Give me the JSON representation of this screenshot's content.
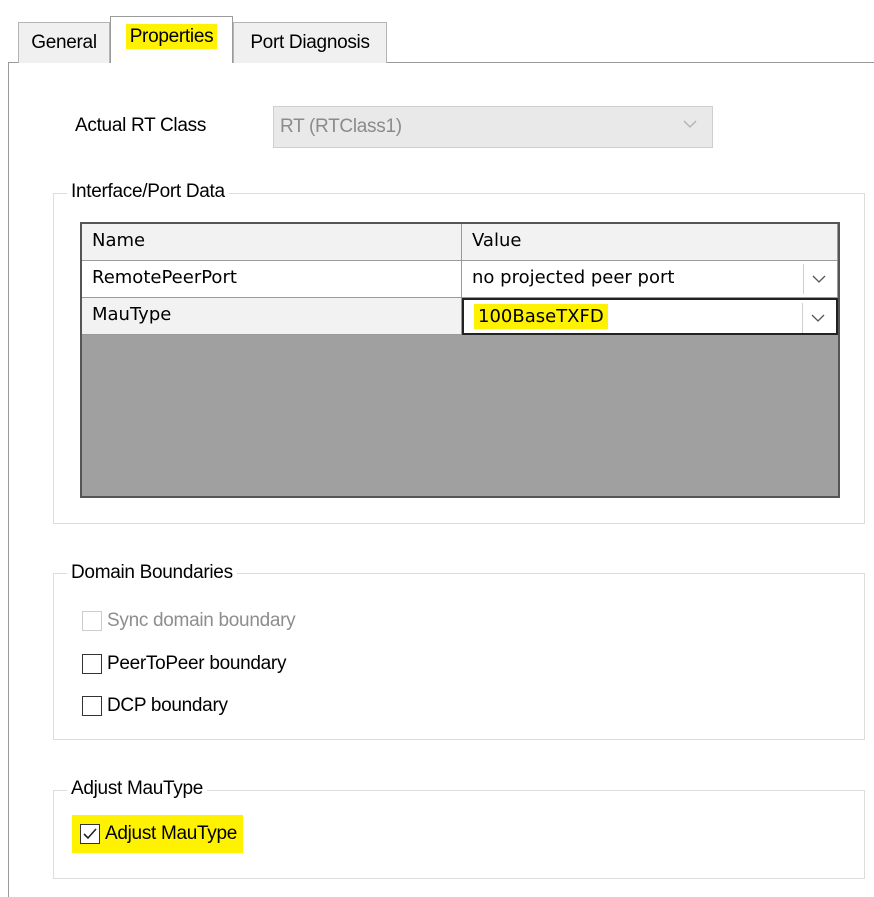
{
  "tabs": [
    {
      "label": "General",
      "active": false
    },
    {
      "label": "Properties",
      "active": true,
      "highlighted": true
    },
    {
      "label": "Port Diagnosis",
      "active": false
    }
  ],
  "rt_class": {
    "label": "Actual RT Class",
    "value": "RT (RTClass1)",
    "enabled": false
  },
  "interface_port_data": {
    "title": "Interface/Port Data",
    "columns": [
      "Name",
      "Value"
    ],
    "rows": [
      {
        "name": "RemotePeerPort",
        "value": "no projected peer port"
      },
      {
        "name": "MauType",
        "value": "100BaseTXFD",
        "selected": true,
        "highlighted": true
      }
    ]
  },
  "domain_boundaries": {
    "title": "Domain Boundaries",
    "items": [
      {
        "label": "Sync domain boundary",
        "checked": false,
        "enabled": false
      },
      {
        "label": "PeerToPeer boundary",
        "checked": false,
        "enabled": true
      },
      {
        "label": "DCP boundary",
        "checked": false,
        "enabled": true
      }
    ]
  },
  "adjust_maotype": {
    "title": "Adjust MauType",
    "checkbox": {
      "label": "Adjust MauType",
      "checked": true,
      "highlighted": true
    }
  },
  "colors": {
    "highlight": "#fff200",
    "grid_empty": "#a0a0a0",
    "disabled_text": "#8d8d8d"
  }
}
